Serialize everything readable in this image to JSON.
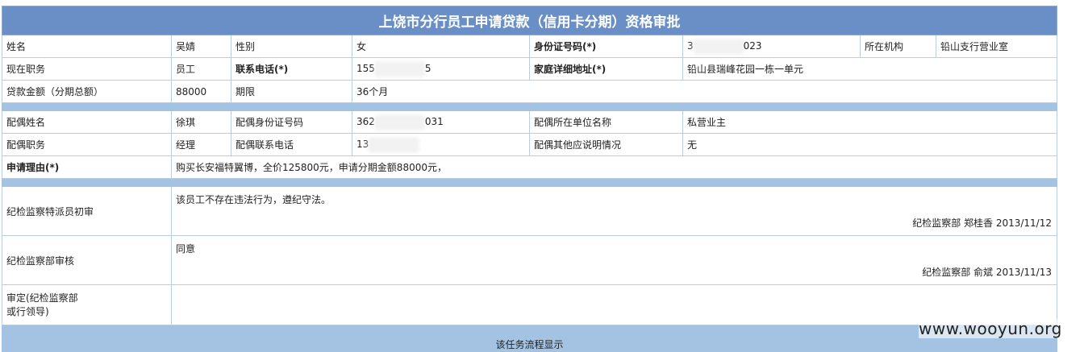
{
  "title": "上饶市分行员工申请贷款（信用卡分期）资格审批",
  "row1": {
    "name_label": "姓名",
    "name": "吴婧",
    "gender_label": "性别",
    "gender": "女",
    "id_label": "身份证号码(*)",
    "id_prefix": "3",
    "id_suffix": "023",
    "org_label": "所在机构",
    "org": "铅山支行营业室"
  },
  "row2": {
    "position_label": "现在职务",
    "position": "员工",
    "phone_label": "联系电话(*)",
    "phone_prefix": "155",
    "phone_suffix": "5",
    "address_label": "家庭详细地址(*)",
    "address": "铅山县瑞峰花园一栋一单元"
  },
  "row3": {
    "amount_label": "贷款金额（分期总额）",
    "amount": "88000",
    "term_label": "期限",
    "term": "36个月"
  },
  "spouse": {
    "name_label": "配偶姓名",
    "name": "徐琪",
    "id_label": "配偶身份证号码",
    "id_prefix": "362",
    "id_suffix": "031",
    "employer_label": "配偶所在单位名称",
    "employer": "私营业主",
    "position_label": "配偶职务",
    "position": "经理",
    "phone_label": "配偶联系电话",
    "phone_prefix": "13",
    "other_label": "配偶其他应说明情况",
    "other": "无"
  },
  "reason": {
    "label": "申请理由(*)",
    "text": "购买长安福特翼博，全价125800元，申请分期金额88000元，"
  },
  "review1": {
    "label": "纪检监察特派员初审",
    "comment": "该员工不存在违法行为，遵纪守法。",
    "signature": "纪检监察部 郑桂香 2013/11/12"
  },
  "review2": {
    "label": "纪检监察部审核",
    "comment": "同意",
    "signature": "纪检监察部 俞斌 2013/11/13"
  },
  "final": {
    "label_line1": "审定(纪检监察部",
    "label_line2": "或行领导)"
  },
  "footer": {
    "text": "该任务流程显示"
  },
  "watermark": "www.wooyun.org",
  "colors": {
    "header_bg": "#6a8fc6",
    "separator_bg": "#a4c3e2",
    "border": "#b9cde5"
  }
}
